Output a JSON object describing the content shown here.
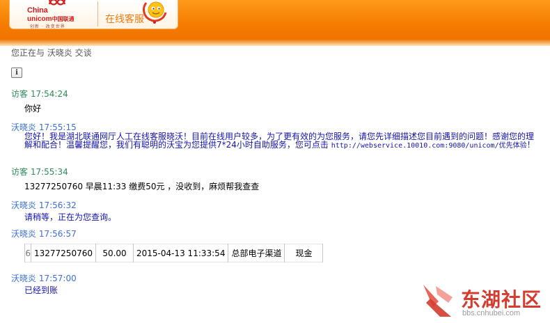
{
  "header": {
    "brand_line1": "China",
    "brand_line2": "unicom",
    "brand_cn": "中国联通",
    "slogan": "创新 · 改变世界",
    "service_label": "在线客服",
    "colors": {
      "bar": "#f47c00",
      "brand_red": "#d21e1e"
    }
  },
  "chat": {
    "topic": "您正在与 沃晓炎 交谈",
    "info_icon": "info-icon",
    "messages": [
      {
        "sender": "访客",
        "time": "17:54:24",
        "role": "visitor",
        "text": "你好"
      },
      {
        "sender": "沃晓炎",
        "time": "17:55:15",
        "role": "agent",
        "text": "您好！我是湖北联通网厅人工在线客服晓沃！目前在线用户较多，为了更有效的为您服务，请您先详细描述您目前遇到的问题！感谢您的理解和配合！温馨提醒您，我们有聪明的沃宝为您提供7*24小时自助服务，您可点击",
        "link": "http://webservice.10010.com:9080/unicom/优先体验",
        "tail": "！"
      },
      {
        "sender": "访客",
        "time": "17:55:34",
        "role": "visitor",
        "text": "13277250760 早晨11:33 缴费50元 ，没收到，麻烦帮我查查"
      },
      {
        "sender": "沃晓炎",
        "time": "17:56:32",
        "role": "agent",
        "text": "请稍等，正在为您查询。"
      },
      {
        "sender": "沃晓炎",
        "time": "17:56:57",
        "role": "agent"
      },
      {
        "sender": "沃晓炎",
        "time": "17:57:00",
        "role": "agent",
        "text": "已经到账"
      }
    ],
    "table": {
      "cells": [
        "6",
        "13277250760",
        "50.00",
        "2015-04-13 11:33:54",
        "总部电子渠道",
        "现金"
      ]
    }
  },
  "watermark": {
    "title": "东湖社区",
    "url": "bbs.cnhubei.com"
  }
}
